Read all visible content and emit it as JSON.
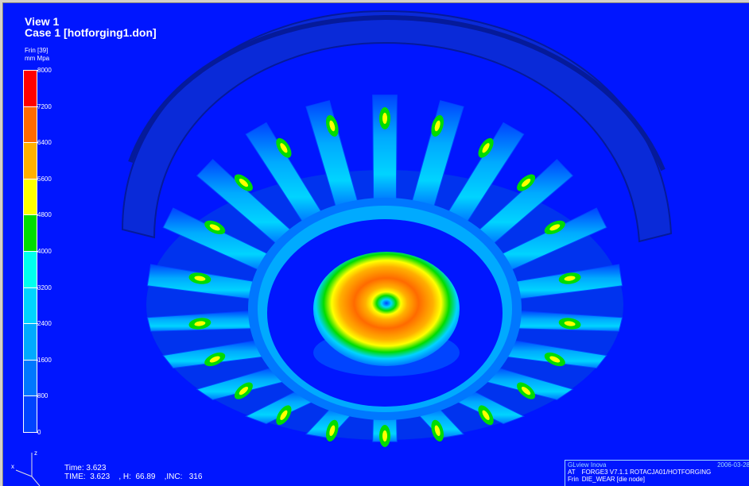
{
  "view": {
    "title": "View 1",
    "case_label": "Case 1  [hotforging1.don]",
    "variable": "Frin [39]",
    "units": "mm Mpa"
  },
  "legend": {
    "ticks": [
      "8000",
      "7200",
      "6400",
      "5600",
      "4800",
      "4000",
      "3200",
      "2400",
      "1600",
      "800",
      "0"
    ],
    "colors": [
      "#ff0000",
      "#ff6a00",
      "#ffb000",
      "#ffff00",
      "#00dc00",
      "#00ffee",
      "#00d4ff",
      "#00aaff",
      "#0077ff",
      "#0044ff"
    ]
  },
  "time": {
    "line1": "Time: 3.623",
    "line2": "TIME:  3.623    , H:  66.89    ,INC:   316"
  },
  "info": {
    "brand": "GLview Inova",
    "date": "2006-03-28",
    "row1_tag": "AT",
    "row1_text": "FORGE3 V7.1.1 ROTACJA01/HOTFORGING",
    "row2_tag": "Frin",
    "row2_text": "DIE_WEAR [die node]"
  },
  "axes": {
    "z": "z",
    "x": "x"
  },
  "colors": {
    "background": "#0016ff",
    "rim": "#0a2ad8",
    "rim_dark": "#051a9a"
  }
}
